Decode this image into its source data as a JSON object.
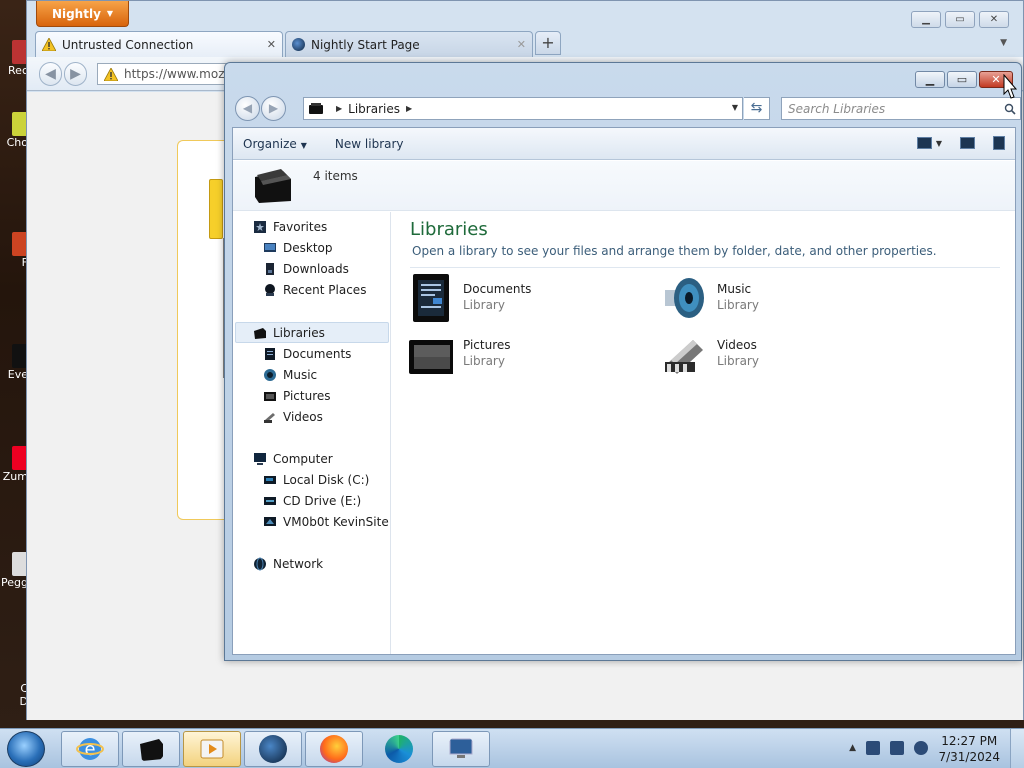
{
  "desktop": {
    "icons": [
      "Rec",
      "Cho",
      "F",
      "Eve",
      "Zum",
      "Pegg",
      "C",
      "D"
    ]
  },
  "firefox": {
    "menu_button": "Nightly",
    "tabs": [
      {
        "label": "Untrusted Connection",
        "icon": "warning-icon",
        "active": true
      },
      {
        "label": "Nightly Start Page",
        "icon": "globe-icon",
        "active": false
      }
    ],
    "url_text": "https://www.moz"
  },
  "explorer": {
    "breadcrumb": [
      "Libraries"
    ],
    "search_placeholder": "Search Libraries",
    "toolbar": {
      "organize": "Organize",
      "new_library": "New library"
    },
    "details_count": "4 items",
    "nav": {
      "favorites": {
        "label": "Favorites",
        "items": [
          "Desktop",
          "Downloads",
          "Recent Places"
        ]
      },
      "libraries": {
        "label": "Libraries",
        "items": [
          "Documents",
          "Music",
          "Pictures",
          "Videos"
        ]
      },
      "computer": {
        "label": "Computer",
        "items": [
          "Local Disk (C:)",
          "CD Drive (E:)",
          "VM0b0t KevinSite"
        ]
      },
      "network": {
        "label": "Network"
      }
    },
    "main": {
      "title": "Libraries",
      "description": "Open a library to see your files and arrange them by folder, date, and other properties.",
      "libraries": [
        {
          "name": "Documents",
          "type": "Library",
          "icon": "documents-library-icon"
        },
        {
          "name": "Music",
          "type": "Library",
          "icon": "music-library-icon"
        },
        {
          "name": "Pictures",
          "type": "Library",
          "icon": "pictures-library-icon"
        },
        {
          "name": "Videos",
          "type": "Library",
          "icon": "videos-library-icon"
        }
      ]
    }
  },
  "taskbar": {
    "buttons": [
      "internet-explorer-icon",
      "libraries-icon",
      "media-player-icon",
      "nightly-globe-icon",
      "firefox-icon",
      "edge-icon",
      "remote-desktop-icon"
    ],
    "time": "12:27 PM",
    "date": "7/31/2024"
  },
  "colors": {
    "nightly_orange": "#e8761c",
    "libraries_title_green": "#1e6a3a",
    "close_button_red": "#c23a22"
  }
}
